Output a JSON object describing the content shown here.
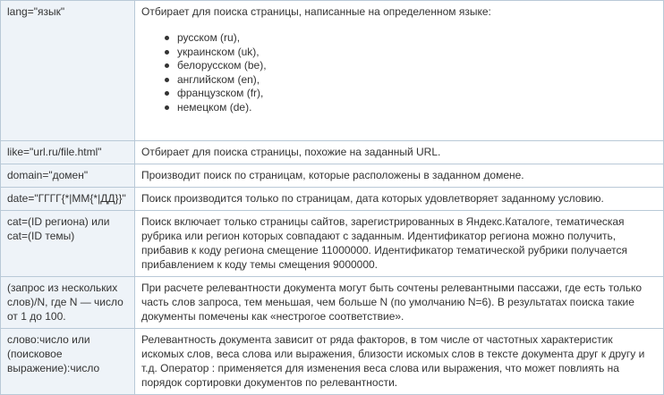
{
  "rows": [
    {
      "operator": "lang=\"язык\"",
      "description": "Отбирает для поиска страницы, написанные на определенном языке:",
      "list": [
        "русском (ru),",
        "украинском (uk),",
        "белорусском (be),",
        "английском (en),",
        "французском (fr),",
        "немецком (de)."
      ]
    },
    {
      "operator": "like=\"url.ru/file.html\"",
      "description": "Отбирает для поиска страницы, похожие на заданный URL."
    },
    {
      "operator": "domain=\"домен\"",
      "description": "Производит поиск по страницам, которые расположены в заданном домене."
    },
    {
      "operator": "date=\"ГГГГ{*|ММ{*|ДД}}\"",
      "description": "Поиск производится только по страницам, дата которых удовлетворяет заданному условию."
    },
    {
      "operator": "cat=(ID региона) или cat=(ID темы)",
      "description": "Поиск включает только страницы сайтов, зарегистрированных в Яндекс.Каталоге, тематическая рубрика или регион которых совпадают с заданным. Идентификатор региона можно получить, прибавив к коду региона смещение 11000000. Идентификатор тематической рубрики получается прибавлением к коду темы смещения 9000000."
    },
    {
      "operator": "(запрос из нескольких слов)/N, где N — число от 1 до 100.",
      "description": "При расчете релевантности документа могут быть сочтены релевантными пассажи, где есть только часть слов запроса, тем меньшая, чем больше N (по умолчанию N=6). В результатах поиска такие документы помечены как «нестрогое соответствие»."
    },
    {
      "operator": "слово:число или (поисковое выражение):число",
      "description": "Релевантность документа зависит от ряда факторов, в том числе от частотных характеристик искомых слов, веса слова или выражения, близости искомых слов в тексте документа друг к другу и т.д. Оператор : применяется для изменения веса слова или выражения, что может повлиять на порядок сортировки документов по релевантности."
    }
  ]
}
